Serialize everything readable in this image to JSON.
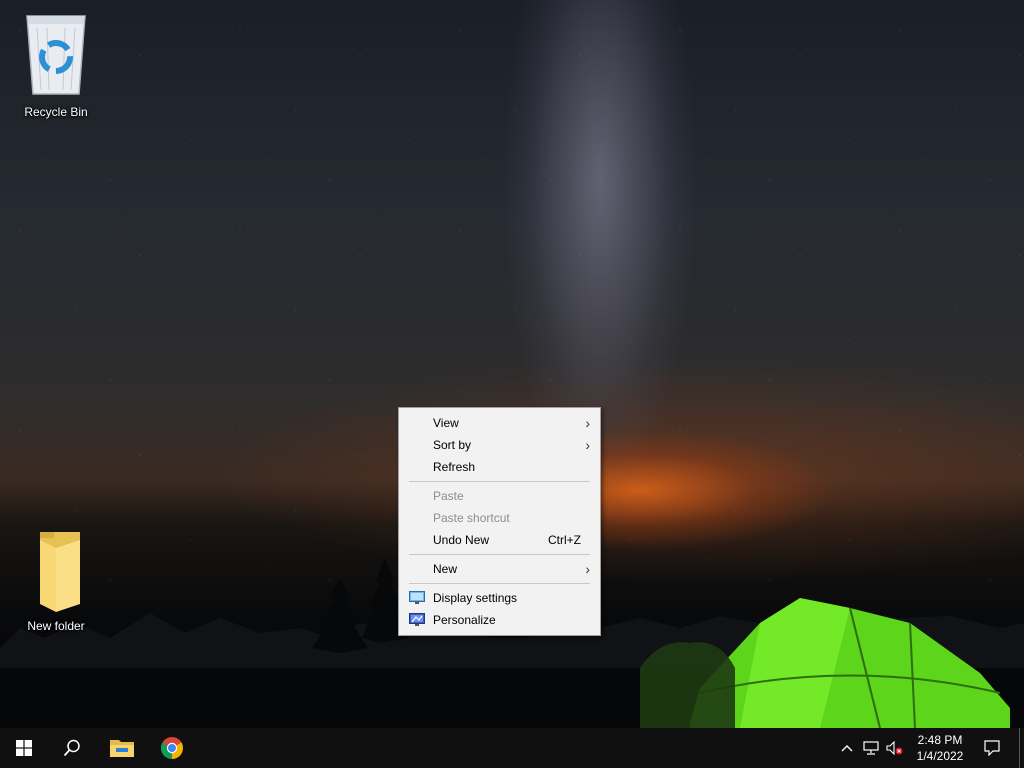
{
  "desktop": {
    "icons": [
      {
        "label": "Recycle Bin",
        "icon": "recycle-bin-icon"
      },
      {
        "label": "New folder",
        "icon": "folder-icon"
      }
    ]
  },
  "context_menu": {
    "items": [
      {
        "label": "View",
        "submenu": true,
        "enabled": true
      },
      {
        "label": "Sort by",
        "submenu": true,
        "enabled": true
      },
      {
        "label": "Refresh",
        "enabled": true
      },
      {
        "label": "Paste",
        "enabled": false
      },
      {
        "label": "Paste shortcut",
        "enabled": false
      },
      {
        "label": "Undo New",
        "shortcut": "Ctrl+Z",
        "enabled": true
      },
      {
        "label": "New",
        "submenu": true,
        "enabled": true
      },
      {
        "label": "Display settings",
        "icon": "display-settings-icon",
        "enabled": true
      },
      {
        "label": "Personalize",
        "icon": "personalize-icon",
        "enabled": true
      }
    ]
  },
  "taskbar": {
    "start_icon": "windows-start-icon",
    "search_icon": "search-icon",
    "pinned": [
      {
        "icon": "file-explorer-icon"
      },
      {
        "icon": "chrome-icon"
      }
    ],
    "tray": {
      "icons": [
        "chevron-up-icon",
        "network-icon",
        "volume-muted-icon"
      ],
      "time": "2:48 PM",
      "date": "1/4/2022",
      "notification_icon": "action-center-icon"
    }
  },
  "colors": {
    "taskbar_bg": "#101010",
    "menu_bg": "#f2f2f2",
    "menu_disabled_text": "#8d8d8d",
    "chrome_red": "#db4437",
    "chrome_green": "#0f9d58",
    "chrome_yellow": "#f4b400",
    "chrome_blue": "#4285f4"
  }
}
